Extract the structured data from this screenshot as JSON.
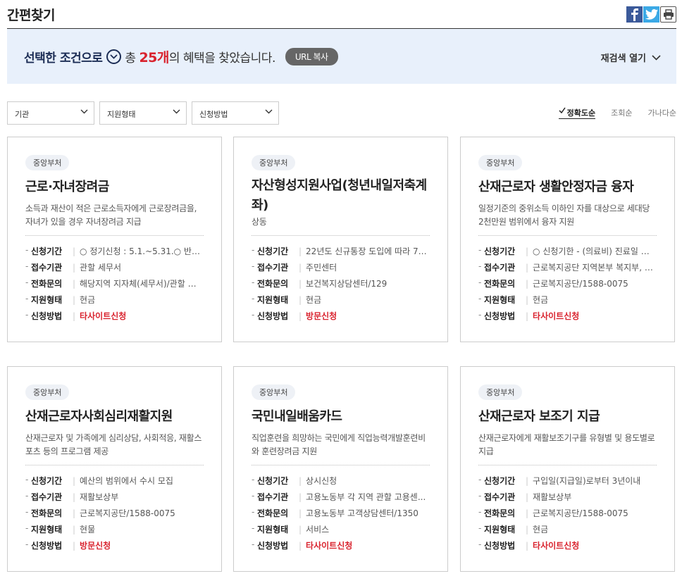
{
  "header": {
    "title": "간편찾기",
    "share_icons": [
      "facebook-icon",
      "twitter-icon",
      "print-icon"
    ]
  },
  "banner": {
    "prefix": "선택한 조건으로",
    "total_label": "총",
    "count": "25개",
    "suffix": "의 혜택을 찾았습니다.",
    "url_button": "URL 복사",
    "research_label": "재검색 열기"
  },
  "filters": [
    {
      "placeholder": "기관"
    },
    {
      "placeholder": "지원형태"
    },
    {
      "placeholder": "신청방법"
    }
  ],
  "sorts": [
    {
      "label": "정확도순",
      "active": true
    },
    {
      "label": "조회순",
      "active": false
    },
    {
      "label": "가나다순",
      "active": false
    }
  ],
  "colors": {
    "accent_red": "#d9232e",
    "banner_bg": "#e8f0fb",
    "navy": "#1c2d55"
  },
  "cards": [
    {
      "badge": "중앙부처",
      "title": "근로·자녀장려금",
      "desc": "소득과 재산이 적은 근로소득자에게 근로장려금을, 자녀가 있을 경우 자녀장려금 지급",
      "rows": [
        {
          "label": "신청기간",
          "value": "○ 정기신청 : 5.1.~5.31.○ 반기신...",
          "red": false
        },
        {
          "label": "접수기관",
          "value": "관할 세무서",
          "red": false
        },
        {
          "label": "전화문의",
          "value": "해당지역 지자체(세무서)/관할 세...",
          "red": false
        },
        {
          "label": "지원형태",
          "value": "현금",
          "red": false
        },
        {
          "label": "신청방법",
          "value": "타사이트신청",
          "red": true
        }
      ]
    },
    {
      "badge": "중앙부처",
      "title": "자산형성지원사업(청년내일저축계좌)",
      "desc": "상동",
      "rows": [
        {
          "label": "신청기간",
          "value": "22년도 신규통장 도입에 따라 7월...",
          "red": false
        },
        {
          "label": "접수기관",
          "value": "주민센터",
          "red": false
        },
        {
          "label": "전화문의",
          "value": "보건복지상담센터/129",
          "red": false
        },
        {
          "label": "지원형태",
          "value": "현금",
          "red": false
        },
        {
          "label": "신청방법",
          "value": "방문신청",
          "red": true
        }
      ]
    },
    {
      "badge": "중앙부처",
      "title": "산재근로자 생활안정자금 융자",
      "desc": "일정기준의 중위소득 이하인 자를 대상으로 세대당 2천만원 범위에서 융자 지원",
      "rows": [
        {
          "label": "신청기간",
          "value": "○ 신청기한 - (의료비) 진료일 또...",
          "red": false
        },
        {
          "label": "접수기관",
          "value": "근로복지공단 지역본부 복지부, 지...",
          "red": false
        },
        {
          "label": "전화문의",
          "value": "근로복지공단/1588-0075",
          "red": false
        },
        {
          "label": "지원형태",
          "value": "현금",
          "red": false
        },
        {
          "label": "신청방법",
          "value": "타사이트신청",
          "red": true
        }
      ]
    },
    {
      "badge": "중앙부처",
      "title": "산재근로자사회심리재활지원",
      "desc": "산재근로자 및 가족에게 심리상담, 사회적응, 재활스포츠 등의 프로그램 제공",
      "rows": [
        {
          "label": "신청기간",
          "value": "예산의 범위에서 수시 모집",
          "red": false
        },
        {
          "label": "접수기관",
          "value": "재활보상부",
          "red": false
        },
        {
          "label": "전화문의",
          "value": "근로복지공단/1588-0075",
          "red": false
        },
        {
          "label": "지원형태",
          "value": "현물",
          "red": false
        },
        {
          "label": "신청방법",
          "value": "방문신청",
          "red": true
        }
      ]
    },
    {
      "badge": "중앙부처",
      "title": "국민내일배움카드",
      "desc": "직업훈련을 희망하는 국민에게 직업능력개발훈련비와 훈련장려금 지원",
      "rows": [
        {
          "label": "신청기간",
          "value": "상시신청",
          "red": false
        },
        {
          "label": "접수기관",
          "value": "고용노동부 각 지역 관할 고용센...",
          "red": false
        },
        {
          "label": "전화문의",
          "value": "고용노동부 고객상담센터/1350",
          "red": false
        },
        {
          "label": "지원형태",
          "value": "서비스",
          "red": false
        },
        {
          "label": "신청방법",
          "value": "타사이트신청",
          "red": true
        }
      ]
    },
    {
      "badge": "중앙부처",
      "title": "산재근로자 보조기 지급",
      "desc": "산재근로자에게 재활보조기구를 유형별 및 용도별로 지급",
      "rows": [
        {
          "label": "신청기간",
          "value": "구입일(지급일)로부터 3년이내",
          "red": false
        },
        {
          "label": "접수기관",
          "value": "재활보상부",
          "red": false
        },
        {
          "label": "전화문의",
          "value": "근로복지공단/1588-0075",
          "red": false
        },
        {
          "label": "지원형태",
          "value": "현금",
          "red": false
        },
        {
          "label": "신청방법",
          "value": "타사이트신청",
          "red": true
        }
      ]
    }
  ]
}
